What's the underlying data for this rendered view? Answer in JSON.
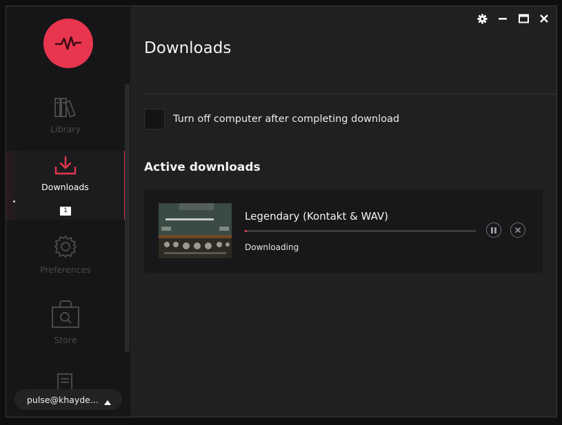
{
  "sidebar": {
    "items": [
      {
        "label": "Library",
        "icon": "library-icon",
        "active": false
      },
      {
        "label": "Downloads",
        "icon": "download-icon",
        "active": true,
        "badge": "1"
      },
      {
        "label": "Preferences",
        "icon": "gear-icon",
        "active": false
      },
      {
        "label": "Store",
        "icon": "store-bag-icon",
        "active": false
      },
      {
        "label": "",
        "icon": "document-icon",
        "active": false
      }
    ],
    "user": "pulse@khayde..."
  },
  "main": {
    "title": "Downloads",
    "shutdown_option": "Turn off computer after completing download",
    "active_section_title": "Active downloads",
    "downloads": [
      {
        "name": "Legendary (Kontakt & WAV)",
        "status": "Downloading",
        "progress": 0.01
      }
    ]
  },
  "colors": {
    "accent": "#e9364f",
    "background": "#202022",
    "sidebar": "#161618"
  }
}
